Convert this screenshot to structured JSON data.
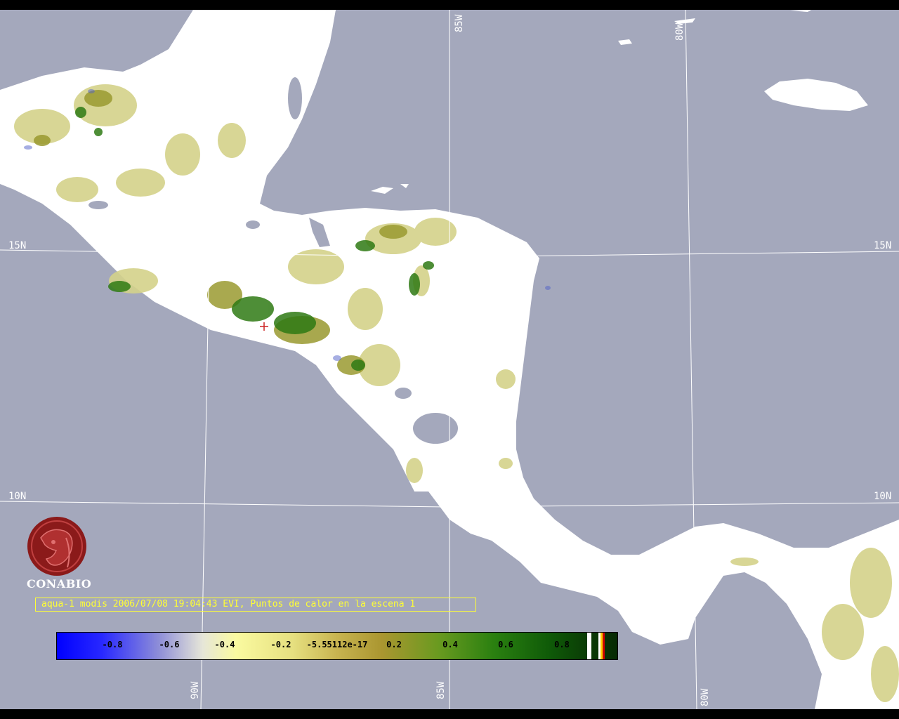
{
  "map": {
    "ocean_color": "#a4a8bc",
    "land_color": "#ffffff",
    "grid_color": "#ffffff",
    "labels": {
      "lon_85w_top": "85W",
      "lon_80w_top": "80W",
      "lon_90w_bottom": "90W",
      "lon_85w_bottom": "85W",
      "lon_80w_bottom": "80W",
      "lat_15n_left": "15N",
      "lat_15n_right": "15N",
      "lat_10n_left": "10N",
      "lat_10n_right": "10N"
    }
  },
  "logo": {
    "text": "CONABIO",
    "color": "#8b1a1a"
  },
  "caption": {
    "text": "aqua-1 modis 2006/07/08 19:04:43 EVI, Puntos de calor en la escena 1",
    "color": "#ffff33"
  },
  "colorbar": {
    "ticks": [
      "-0.8",
      "-0.6",
      "-0.4",
      "-0.2",
      "-5.55112e-17",
      "0.2",
      "0.4",
      "0.6",
      "0.8"
    ]
  }
}
